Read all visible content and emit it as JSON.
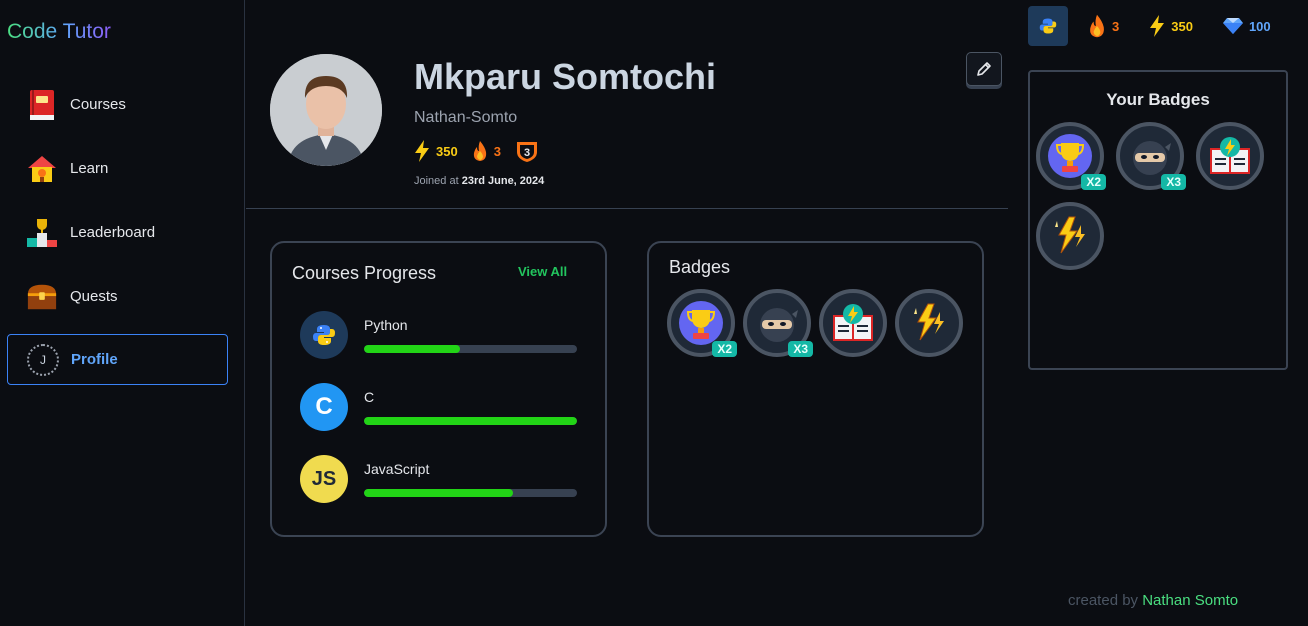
{
  "app": {
    "logo": "Code Tutor"
  },
  "sidebar": {
    "items": [
      {
        "label": "Courses",
        "icon": "book-icon"
      },
      {
        "label": "Learn",
        "icon": "school-icon"
      },
      {
        "label": "Leaderboard",
        "icon": "podium-icon"
      },
      {
        "label": "Quests",
        "icon": "treasure-chest-icon"
      },
      {
        "label": "Profile",
        "icon": "profile-icon",
        "avatar_letter": "J",
        "active": true
      }
    ]
  },
  "profile": {
    "name": "Mkparu Somtochi",
    "username": "Nathan-Somto",
    "xp": "350",
    "streak": "3",
    "level": "3",
    "joined_prefix": "Joined at",
    "joined_date": "23rd June, 2024"
  },
  "courses_progress": {
    "title": "Courses Progress",
    "view_all": "View All",
    "courses": [
      {
        "name": "Python",
        "progress": 0.45,
        "icon_text": "",
        "color": "#1e3a5a"
      },
      {
        "name": "C",
        "progress": 1.0,
        "icon_text": "C",
        "color": "#2196f3"
      },
      {
        "name": "JavaScript",
        "progress": 0.7,
        "icon_text": "JS",
        "color": "#f0db4f"
      }
    ]
  },
  "badges_card": {
    "title": "Badges",
    "badges": [
      {
        "name": "trophy",
        "count": "X2"
      },
      {
        "name": "ninja",
        "count": "X3"
      },
      {
        "name": "book-lightning",
        "count": ""
      },
      {
        "name": "lightning",
        "count": ""
      }
    ]
  },
  "topbar": {
    "course": "python-icon",
    "streak": "3",
    "xp": "350",
    "gems": "100"
  },
  "your_badges": {
    "title": "Your Badges",
    "badges": [
      {
        "name": "trophy",
        "count": "X2"
      },
      {
        "name": "ninja",
        "count": "X3"
      },
      {
        "name": "book-lightning",
        "count": ""
      },
      {
        "name": "lightning",
        "count": ""
      }
    ]
  },
  "footer": {
    "prefix": "created by",
    "author": "Nathan Somto"
  },
  "colors": {
    "accent_green": "#22c55e",
    "accent_blue": "#3b82f6",
    "xp_yellow": "#facc15",
    "fire_orange": "#f97316",
    "gem_blue": "#60a5fa"
  }
}
